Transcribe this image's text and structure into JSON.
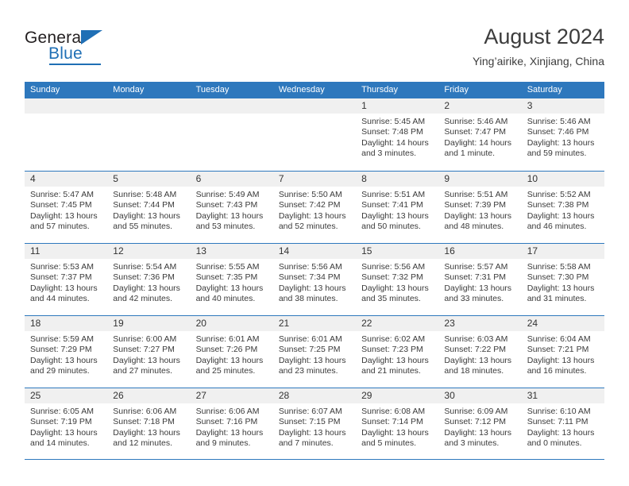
{
  "brand": {
    "name_top": "General",
    "name_bottom": "Blue",
    "accent_color": "#1f6fb5"
  },
  "header": {
    "title": "August 2024",
    "subtitle": "Ying’airike, Xinjiang, China"
  },
  "theme": {
    "header_band": "#2e78bd",
    "day_band": "#f0f0f0",
    "text": "#3a3a3a"
  },
  "weekdays": [
    "Sunday",
    "Monday",
    "Tuesday",
    "Wednesday",
    "Thursday",
    "Friday",
    "Saturday"
  ],
  "weeks": [
    [
      {
        "day": "",
        "sunrise": "",
        "sunset": "",
        "daylight1": "",
        "daylight2": "",
        "empty": true
      },
      {
        "day": "",
        "sunrise": "",
        "sunset": "",
        "daylight1": "",
        "daylight2": "",
        "empty": true
      },
      {
        "day": "",
        "sunrise": "",
        "sunset": "",
        "daylight1": "",
        "daylight2": "",
        "empty": true
      },
      {
        "day": "",
        "sunrise": "",
        "sunset": "",
        "daylight1": "",
        "daylight2": "",
        "empty": true
      },
      {
        "day": "1",
        "sunrise": "Sunrise: 5:45 AM",
        "sunset": "Sunset: 7:48 PM",
        "daylight1": "Daylight: 14 hours",
        "daylight2": "and 3 minutes.",
        "empty": false
      },
      {
        "day": "2",
        "sunrise": "Sunrise: 5:46 AM",
        "sunset": "Sunset: 7:47 PM",
        "daylight1": "Daylight: 14 hours",
        "daylight2": "and 1 minute.",
        "empty": false
      },
      {
        "day": "3",
        "sunrise": "Sunrise: 5:46 AM",
        "sunset": "Sunset: 7:46 PM",
        "daylight1": "Daylight: 13 hours",
        "daylight2": "and 59 minutes.",
        "empty": false
      }
    ],
    [
      {
        "day": "4",
        "sunrise": "Sunrise: 5:47 AM",
        "sunset": "Sunset: 7:45 PM",
        "daylight1": "Daylight: 13 hours",
        "daylight2": "and 57 minutes.",
        "empty": false
      },
      {
        "day": "5",
        "sunrise": "Sunrise: 5:48 AM",
        "sunset": "Sunset: 7:44 PM",
        "daylight1": "Daylight: 13 hours",
        "daylight2": "and 55 minutes.",
        "empty": false
      },
      {
        "day": "6",
        "sunrise": "Sunrise: 5:49 AM",
        "sunset": "Sunset: 7:43 PM",
        "daylight1": "Daylight: 13 hours",
        "daylight2": "and 53 minutes.",
        "empty": false
      },
      {
        "day": "7",
        "sunrise": "Sunrise: 5:50 AM",
        "sunset": "Sunset: 7:42 PM",
        "daylight1": "Daylight: 13 hours",
        "daylight2": "and 52 minutes.",
        "empty": false
      },
      {
        "day": "8",
        "sunrise": "Sunrise: 5:51 AM",
        "sunset": "Sunset: 7:41 PM",
        "daylight1": "Daylight: 13 hours",
        "daylight2": "and 50 minutes.",
        "empty": false
      },
      {
        "day": "9",
        "sunrise": "Sunrise: 5:51 AM",
        "sunset": "Sunset: 7:39 PM",
        "daylight1": "Daylight: 13 hours",
        "daylight2": "and 48 minutes.",
        "empty": false
      },
      {
        "day": "10",
        "sunrise": "Sunrise: 5:52 AM",
        "sunset": "Sunset: 7:38 PM",
        "daylight1": "Daylight: 13 hours",
        "daylight2": "and 46 minutes.",
        "empty": false
      }
    ],
    [
      {
        "day": "11",
        "sunrise": "Sunrise: 5:53 AM",
        "sunset": "Sunset: 7:37 PM",
        "daylight1": "Daylight: 13 hours",
        "daylight2": "and 44 minutes.",
        "empty": false
      },
      {
        "day": "12",
        "sunrise": "Sunrise: 5:54 AM",
        "sunset": "Sunset: 7:36 PM",
        "daylight1": "Daylight: 13 hours",
        "daylight2": "and 42 minutes.",
        "empty": false
      },
      {
        "day": "13",
        "sunrise": "Sunrise: 5:55 AM",
        "sunset": "Sunset: 7:35 PM",
        "daylight1": "Daylight: 13 hours",
        "daylight2": "and 40 minutes.",
        "empty": false
      },
      {
        "day": "14",
        "sunrise": "Sunrise: 5:56 AM",
        "sunset": "Sunset: 7:34 PM",
        "daylight1": "Daylight: 13 hours",
        "daylight2": "and 38 minutes.",
        "empty": false
      },
      {
        "day": "15",
        "sunrise": "Sunrise: 5:56 AM",
        "sunset": "Sunset: 7:32 PM",
        "daylight1": "Daylight: 13 hours",
        "daylight2": "and 35 minutes.",
        "empty": false
      },
      {
        "day": "16",
        "sunrise": "Sunrise: 5:57 AM",
        "sunset": "Sunset: 7:31 PM",
        "daylight1": "Daylight: 13 hours",
        "daylight2": "and 33 minutes.",
        "empty": false
      },
      {
        "day": "17",
        "sunrise": "Sunrise: 5:58 AM",
        "sunset": "Sunset: 7:30 PM",
        "daylight1": "Daylight: 13 hours",
        "daylight2": "and 31 minutes.",
        "empty": false
      }
    ],
    [
      {
        "day": "18",
        "sunrise": "Sunrise: 5:59 AM",
        "sunset": "Sunset: 7:29 PM",
        "daylight1": "Daylight: 13 hours",
        "daylight2": "and 29 minutes.",
        "empty": false
      },
      {
        "day": "19",
        "sunrise": "Sunrise: 6:00 AM",
        "sunset": "Sunset: 7:27 PM",
        "daylight1": "Daylight: 13 hours",
        "daylight2": "and 27 minutes.",
        "empty": false
      },
      {
        "day": "20",
        "sunrise": "Sunrise: 6:01 AM",
        "sunset": "Sunset: 7:26 PM",
        "daylight1": "Daylight: 13 hours",
        "daylight2": "and 25 minutes.",
        "empty": false
      },
      {
        "day": "21",
        "sunrise": "Sunrise: 6:01 AM",
        "sunset": "Sunset: 7:25 PM",
        "daylight1": "Daylight: 13 hours",
        "daylight2": "and 23 minutes.",
        "empty": false
      },
      {
        "day": "22",
        "sunrise": "Sunrise: 6:02 AM",
        "sunset": "Sunset: 7:23 PM",
        "daylight1": "Daylight: 13 hours",
        "daylight2": "and 21 minutes.",
        "empty": false
      },
      {
        "day": "23",
        "sunrise": "Sunrise: 6:03 AM",
        "sunset": "Sunset: 7:22 PM",
        "daylight1": "Daylight: 13 hours",
        "daylight2": "and 18 minutes.",
        "empty": false
      },
      {
        "day": "24",
        "sunrise": "Sunrise: 6:04 AM",
        "sunset": "Sunset: 7:21 PM",
        "daylight1": "Daylight: 13 hours",
        "daylight2": "and 16 minutes.",
        "empty": false
      }
    ],
    [
      {
        "day": "25",
        "sunrise": "Sunrise: 6:05 AM",
        "sunset": "Sunset: 7:19 PM",
        "daylight1": "Daylight: 13 hours",
        "daylight2": "and 14 minutes.",
        "empty": false
      },
      {
        "day": "26",
        "sunrise": "Sunrise: 6:06 AM",
        "sunset": "Sunset: 7:18 PM",
        "daylight1": "Daylight: 13 hours",
        "daylight2": "and 12 minutes.",
        "empty": false
      },
      {
        "day": "27",
        "sunrise": "Sunrise: 6:06 AM",
        "sunset": "Sunset: 7:16 PM",
        "daylight1": "Daylight: 13 hours",
        "daylight2": "and 9 minutes.",
        "empty": false
      },
      {
        "day": "28",
        "sunrise": "Sunrise: 6:07 AM",
        "sunset": "Sunset: 7:15 PM",
        "daylight1": "Daylight: 13 hours",
        "daylight2": "and 7 minutes.",
        "empty": false
      },
      {
        "day": "29",
        "sunrise": "Sunrise: 6:08 AM",
        "sunset": "Sunset: 7:14 PM",
        "daylight1": "Daylight: 13 hours",
        "daylight2": "and 5 minutes.",
        "empty": false
      },
      {
        "day": "30",
        "sunrise": "Sunrise: 6:09 AM",
        "sunset": "Sunset: 7:12 PM",
        "daylight1": "Daylight: 13 hours",
        "daylight2": "and 3 minutes.",
        "empty": false
      },
      {
        "day": "31",
        "sunrise": "Sunrise: 6:10 AM",
        "sunset": "Sunset: 7:11 PM",
        "daylight1": "Daylight: 13 hours",
        "daylight2": "and 0 minutes.",
        "empty": false
      }
    ]
  ]
}
